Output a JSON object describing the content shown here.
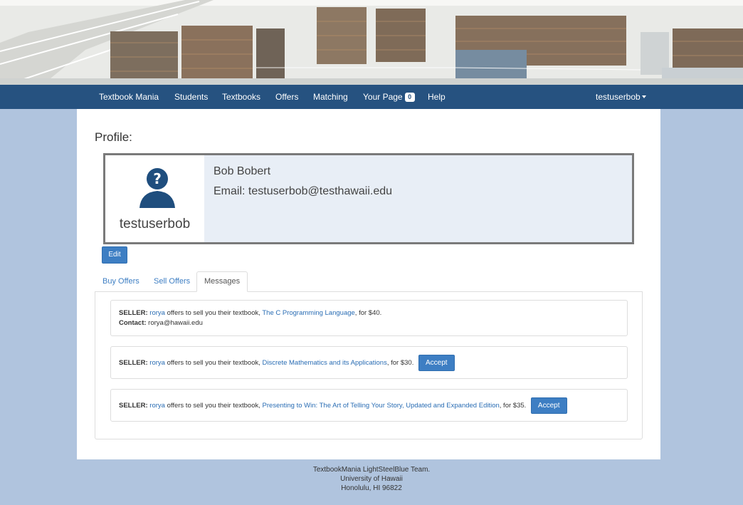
{
  "nav": {
    "brand": "Textbook Mania",
    "items": [
      "Students",
      "Textbooks",
      "Offers",
      "Matching"
    ],
    "your_page": "Your Page",
    "badge_count": "0",
    "help": "Help",
    "user": "testuserbob"
  },
  "profile": {
    "title": "Profile:",
    "username": "testuserbob",
    "full_name": "Bob Bobert",
    "email_line": "Email: testuserbob@testhawaii.edu",
    "edit_label": "Edit"
  },
  "tabs": [
    "Buy Offers",
    "Sell Offers",
    "Messages"
  ],
  "messages": [
    {
      "role": "SELLER:",
      "seller": "rorya",
      "text_before": "offers to sell you their textbook,",
      "book": "The C Programming Language",
      "price": ", for $40.",
      "contact_label": "Contact:",
      "contact": "rorya@hawaii.edu"
    },
    {
      "role": "SELLER:",
      "seller": "rorya",
      "text_before": "offers to sell you their textbook,",
      "book": "Discrete Mathematics and its Applications",
      "price": ", for $30.",
      "accept": "Accept"
    },
    {
      "role": "SELLER:",
      "seller": "rorya",
      "text_before": "offers to sell you their textbook,",
      "book": "Presenting to Win: The Art of Telling Your Story, Updated and Expanded Edition",
      "price": ", for $35.",
      "accept": "Accept"
    }
  ],
  "footer": {
    "line1": "TextbookMania LightSteelBlue Team.",
    "line2": "University of Hawaii",
    "line3": "Honolulu, HI 96822"
  },
  "colors": {
    "navbar": "#265280",
    "page_bg": "#b0c4de",
    "button": "#3d7ec3",
    "link": "#2a6db4",
    "card_bg": "#e8eef6"
  }
}
